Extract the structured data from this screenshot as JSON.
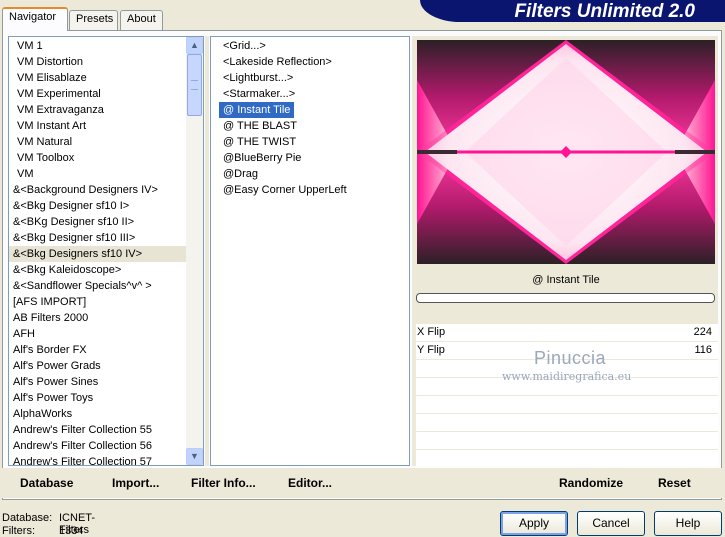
{
  "tabs": [
    {
      "label": "Navigator"
    },
    {
      "label": "Presets"
    },
    {
      "label": "About"
    }
  ],
  "app_title": "Filters Unlimited 2.0",
  "categories": [
    "VM 1",
    "VM Distortion",
    "VM Elisablaze",
    "VM Experimental",
    "VM Extravaganza",
    "VM Instant Art",
    "VM Natural",
    "VM Toolbox",
    "VM",
    "&<Background Designers IV>",
    "&<Bkg Designer sf10 I>",
    "&<BKg Designer sf10 II>",
    "&<Bkg Designer sf10 III>",
    "&<Bkg Designers sf10 IV>",
    "&<Bkg Kaleidoscope>",
    "&<Sandflower Specials^v^ >",
    "[AFS IMPORT]",
    "AB Filters 2000",
    "AFH",
    "Alf's Border FX",
    "Alf's Power Grads",
    "Alf's Power Sines",
    "Alf's Power Toys",
    "AlphaWorks",
    "Andrew's Filter Collection 55",
    "Andrew's Filter Collection 56",
    "Andrew's Filter Collection 57"
  ],
  "selected_category_index": 13,
  "filters": [
    "<Grid...>",
    "<Lakeside Reflection>",
    "<Lightburst...>",
    "<Starmaker...>",
    "@ Instant Tile",
    "@ THE BLAST",
    "@ THE TWIST",
    "@BlueBerry Pie",
    "@Drag",
    "@Easy Corner UpperLeft"
  ],
  "selected_filter_index": 4,
  "preview": {
    "filter_name": "@ Instant Tile",
    "colors": {
      "pink": "#ff1493",
      "dark": "#3a2a33",
      "light": "#ffffff"
    }
  },
  "params": [
    {
      "name": "X Flip",
      "value": "224"
    },
    {
      "name": "Y Flip",
      "value": "116"
    }
  ],
  "watermark": {
    "line1": "Pinuccia",
    "line2": "www.maidiregrafica.eu"
  },
  "bottom_links": {
    "database": "Database",
    "import": "Import...",
    "filter_info": "Filter Info...",
    "editor": "Editor...",
    "randomize": "Randomize",
    "reset": "Reset"
  },
  "status": {
    "database_label": "Database:",
    "database_value": "ICNET-Filters",
    "filters_label": "Filters:",
    "filters_value": "1334"
  },
  "buttons": {
    "apply": "Apply",
    "cancel": "Cancel",
    "help": "Help"
  }
}
